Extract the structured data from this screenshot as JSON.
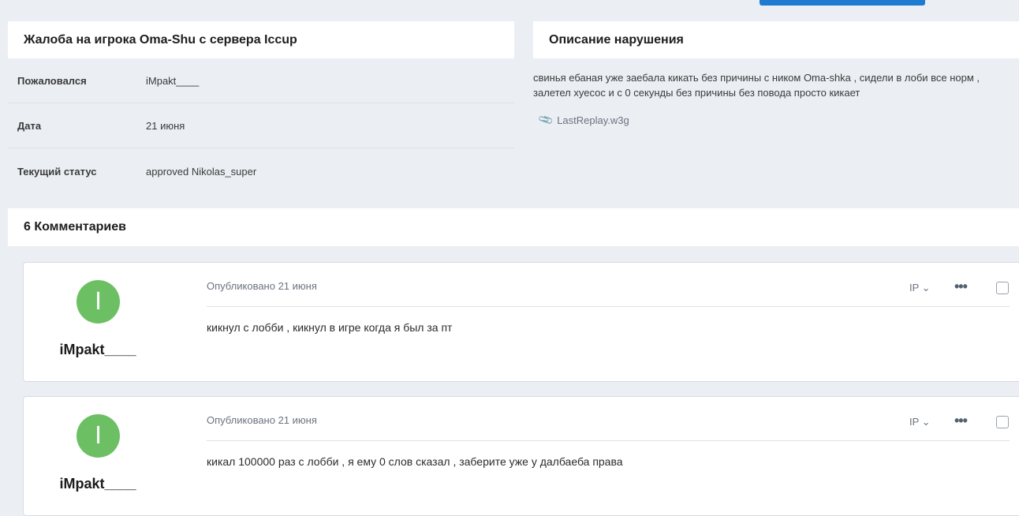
{
  "report": {
    "title": "Жалоба на игрока Oma-Shu с сервера Iccup",
    "rows": [
      {
        "label": "Пожаловался",
        "value": "iMpakt____"
      },
      {
        "label": "Дата",
        "value": "21 июня"
      },
      {
        "label": "Текущий статус",
        "value": "approved Nikolas_super"
      }
    ]
  },
  "description": {
    "title": "Описание нарушения",
    "text": "свинья ебаная уже заебала кикать без причины с ником Oma-shka , сидели в лоби все норм , залетел хуесос и с 0 секунды без причины без повода просто кикает",
    "attachment": "LastReplay.w3g"
  },
  "comments": {
    "title": "6 Комментариев",
    "items": [
      {
        "avatar_letter": "I",
        "author": "iMpakt____",
        "meta": "Опубликовано 21 июня",
        "text": "кикнул с лобби , кикнул в игре когда я был за пт",
        "ip_label": "IP ⌄"
      },
      {
        "avatar_letter": "I",
        "author": "iMpakt____",
        "meta": "Опубликовано 21 июня",
        "text": "кикал 100000 раз с лобби , я ему 0 слов сказал , заберите уже у далбаеба права",
        "ip_label": "IP ⌄"
      }
    ]
  },
  "colors": {
    "accent": "#1f7bd1",
    "avatar": "#6cc063",
    "background": "#ebeef3"
  }
}
